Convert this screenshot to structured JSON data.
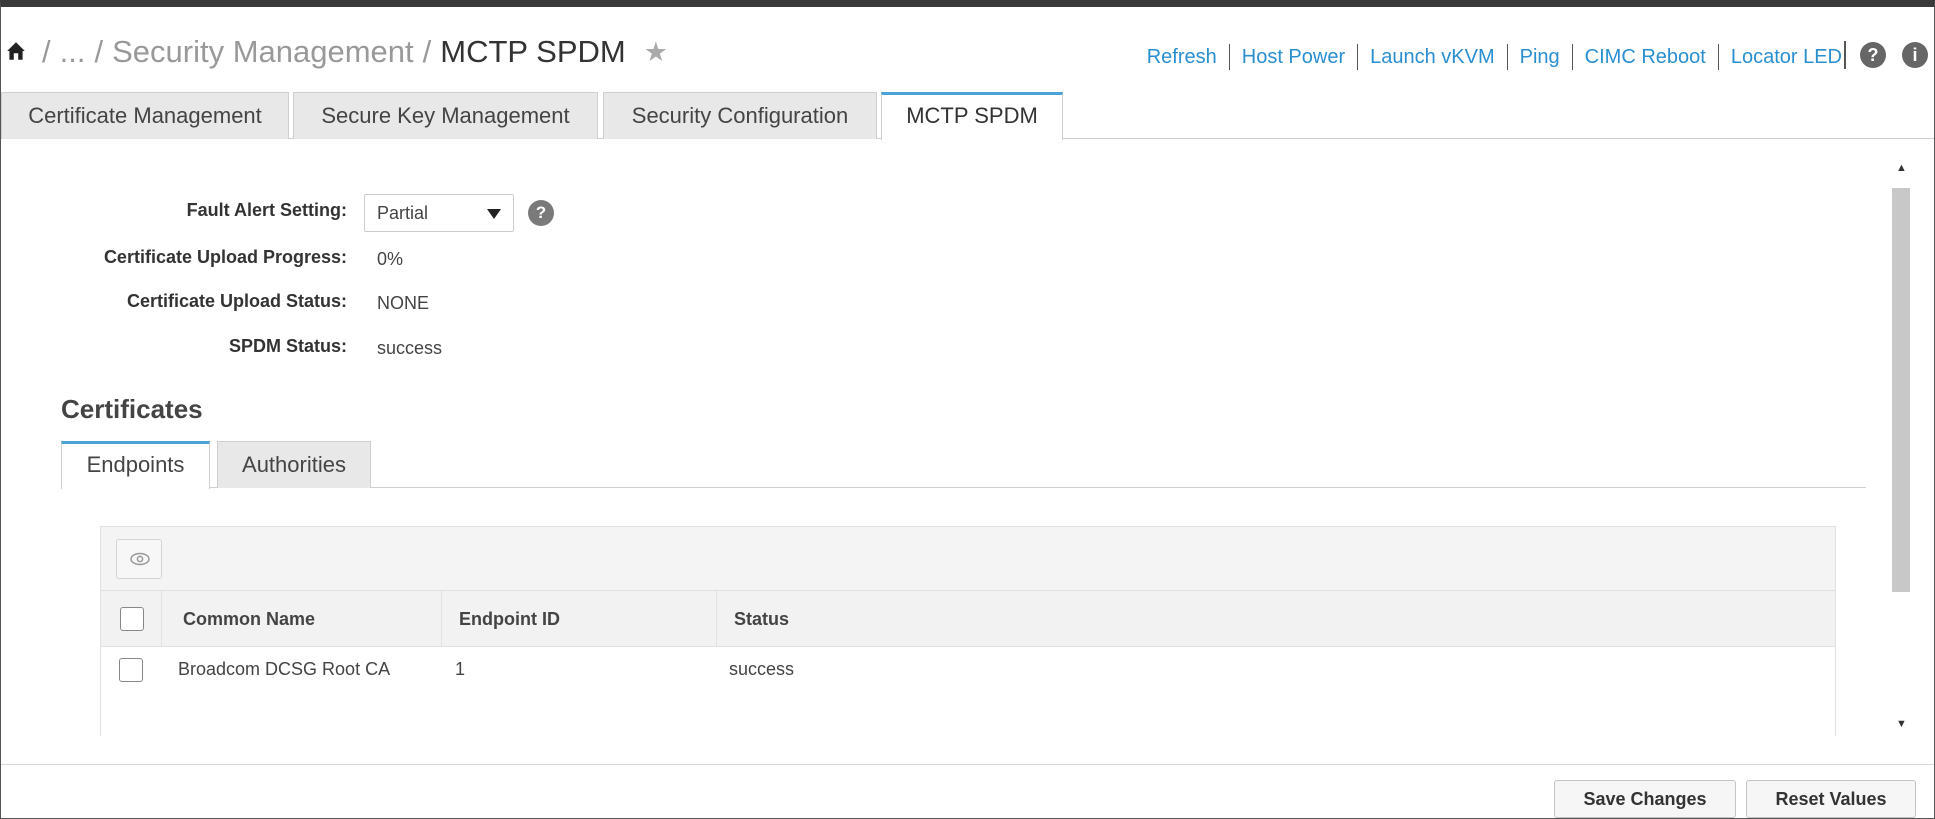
{
  "header": {
    "breadcrumb": {
      "ellipsis": "...",
      "parent": "Security Management",
      "current": "MCTP SPDM"
    },
    "actions": [
      "Refresh",
      "Host Power",
      "Launch vKVM",
      "Ping",
      "CIMC Reboot",
      "Locator LED"
    ]
  },
  "tabs": [
    "Certificate Management",
    "Secure Key Management",
    "Security Configuration",
    "MCTP SPDM"
  ],
  "active_tab": "MCTP SPDM",
  "form": {
    "fault_alert_label": "Fault Alert Setting:",
    "fault_alert_value": "Partial",
    "upload_progress_label": "Certificate Upload Progress:",
    "upload_progress_value": "0%",
    "upload_status_label": "Certificate Upload Status:",
    "upload_status_value": "NONE",
    "spdm_status_label": "SPDM Status:",
    "spdm_status_value": "success"
  },
  "certificates": {
    "title": "Certificates",
    "subtabs": [
      "Endpoints",
      "Authorities"
    ],
    "active_subtab": "Endpoints",
    "columns": [
      "Common Name",
      "Endpoint ID",
      "Status"
    ],
    "rows": [
      {
        "common_name": "Broadcom DCSG Root CA",
        "endpoint_id": "1",
        "status": "success"
      }
    ]
  },
  "footer": {
    "save_label": "Save Changes",
    "reset_label": "Reset Values"
  },
  "colors": {
    "link": "#2a8fd0",
    "active_tab_accent": "#4aa3d8"
  },
  "icons": {
    "home": "home-icon",
    "favorite": "star-icon",
    "help": "help-icon",
    "info": "info-icon",
    "column_visibility": "eye-icon"
  }
}
